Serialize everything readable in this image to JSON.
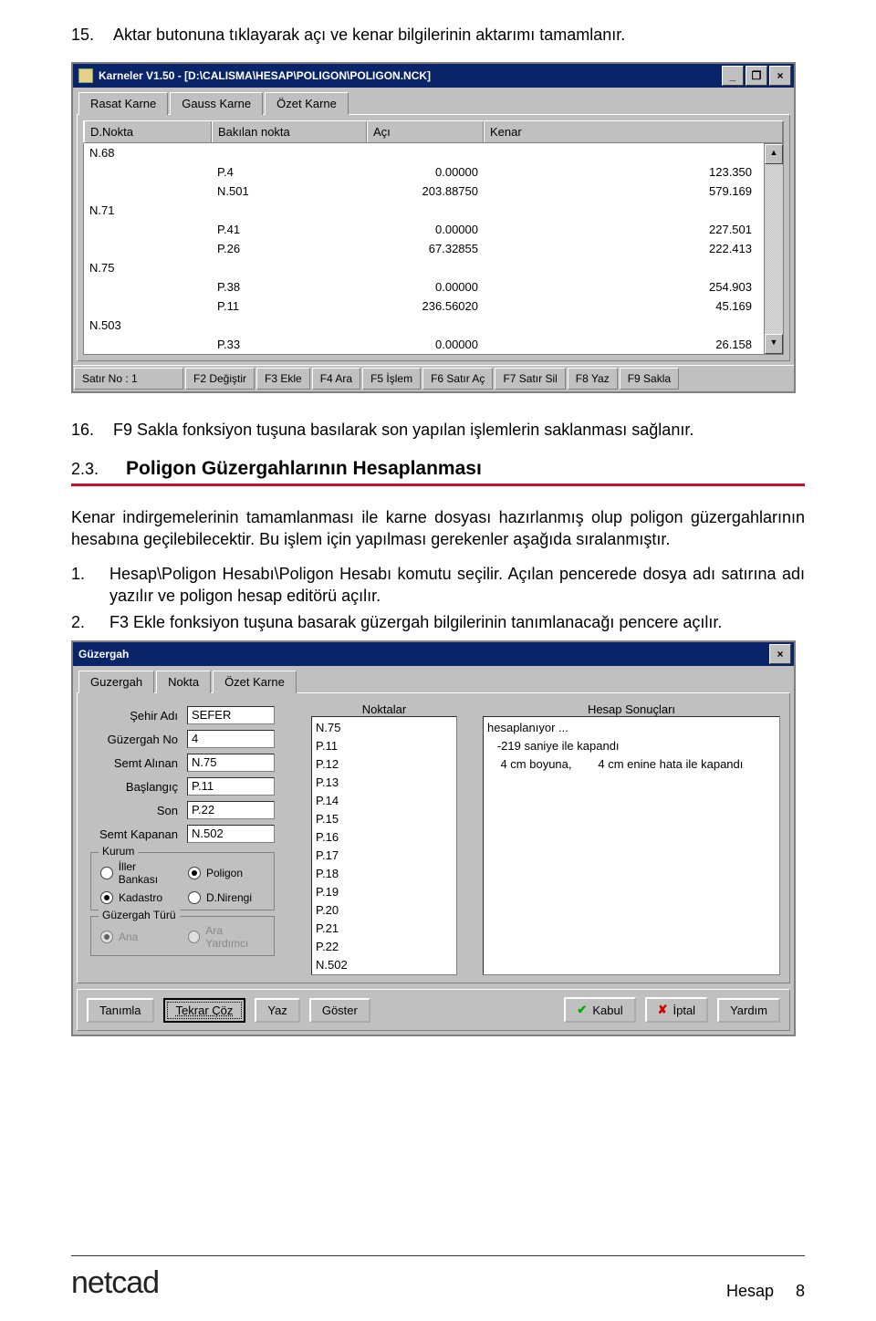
{
  "intro": {
    "item15_num": "15.",
    "item15_text": "Aktar butonuna tıklayarak açı ve kenar bilgilerinin aktarımı tamamlanır."
  },
  "karneler_window": {
    "title": "Karneler V1.50 - [D:\\CALISMA\\HESAP\\POLIGON\\POLIGON.NCK]",
    "min": "_",
    "max": "❐",
    "close": "×",
    "tabs": {
      "t1": "Rasat Karne",
      "t2": "Gauss Karne",
      "t3": "Özet Karne"
    },
    "headers": {
      "c0": "D.Nokta",
      "c1": "Bakılan nokta",
      "c2": "Açı",
      "c3": "Kenar"
    },
    "rows": [
      {
        "c0": "N.68",
        "c1": "",
        "c2": "",
        "c3": "",
        "hl": true
      },
      {
        "c0": "",
        "c1": "P.4",
        "c2": "0.00000",
        "c3": "123.350"
      },
      {
        "c0": "",
        "c1": "N.501",
        "c2": "203.88750",
        "c3": "579.169"
      },
      {
        "c0": "N.71",
        "c1": "",
        "c2": "",
        "c3": "",
        "hl": true
      },
      {
        "c0": "",
        "c1": "P.41",
        "c2": "0.00000",
        "c3": "227.501"
      },
      {
        "c0": "",
        "c1": "P.26",
        "c2": "67.32855",
        "c3": "222.413"
      },
      {
        "c0": "N.75",
        "c1": "",
        "c2": "",
        "c3": "",
        "hl": true
      },
      {
        "c0": "",
        "c1": "P.38",
        "c2": "0.00000",
        "c3": "254.903"
      },
      {
        "c0": "",
        "c1": "P.11",
        "c2": "236.56020",
        "c3": "45.169"
      },
      {
        "c0": "N.503",
        "c1": "",
        "c2": "",
        "c3": "",
        "hl": true
      },
      {
        "c0": "",
        "c1": "P.33",
        "c2": "0.00000",
        "c3": "26.158"
      }
    ],
    "scroll_up": "▲",
    "scroll_down": "▼",
    "status": {
      "s0": "Satır No : 1",
      "s1": "F2 Değiştir",
      "s2": "F3 Ekle",
      "s3": "F4 Ara",
      "s4": "F5 İşlem",
      "s5": "F6 Satır Aç",
      "s6": "F7 Satır Sil",
      "s7": "F8 Yaz",
      "s8": "F9 Sakla"
    }
  },
  "post_text": {
    "item16_num": "16.",
    "item16_text": "F9 Sakla fonksiyon tuşuna basılarak son yapılan işlemlerin saklanması sağlanır."
  },
  "section": {
    "num": "2.3.",
    "title": "Poligon Güzergahlarının Hesaplanması"
  },
  "para1": "Kenar indirgemelerinin tamamlanması ile karne dosyası hazırlanmış olup poligon güzergahlarının hesabına geçilebilecektir. Bu işlem için yapılması gerekenler aşağıda sıralanmıştır.",
  "steps": {
    "s1_num": "1.",
    "s1_text": "Hesap\\Poligon Hesabı\\Poligon Hesabı komutu seçilir. Açılan pencerede dosya adı satırına  adı yazılır ve poligon hesap editörü açılır.",
    "s2_num": "2.",
    "s2_text": "F3 Ekle fonksiyon tuşuna basarak güzergah bilgilerinin tanımlanacağı pencere açılır."
  },
  "guzergah_window": {
    "title": "Güzergah",
    "close": "×",
    "tabs": {
      "t1": "Guzergah",
      "t2": "Nokta",
      "t3": "Özet Karne"
    },
    "labels": {
      "sehir": "Şehir Adı",
      "guzno": "Güzergah No",
      "semta": "Semt Alınan",
      "bas": "Başlangıç",
      "son": "Son",
      "semtk": "Semt Kapanan"
    },
    "values": {
      "sehir": "SEFER",
      "guzno": "4",
      "semta": "N.75",
      "bas": "P.11",
      "son": "P.22",
      "semtk": "N.502"
    },
    "kurum": {
      "legend": "Kurum",
      "r1": "İller Bankası",
      "r2": "Poligon",
      "r3": "Kadastro",
      "r4": "D.Nirengi"
    },
    "turu": {
      "legend": "Güzergah Türü",
      "r1": "Ana",
      "r2": "Ara Yardımcı"
    },
    "noktalar_head": "Noktalar",
    "sonuc_head": "Hesap Sonuçları",
    "noktalar": [
      "N.75",
      "P.11",
      "P.12",
      "P.13",
      "P.14",
      "P.15",
      "P.16",
      "P.17",
      "P.18",
      "P.19",
      "P.20",
      "P.21",
      "P.22",
      "N.502"
    ],
    "sonuc": [
      "hesaplanıyor ...",
      "   -219 saniye ile kapandı",
      "    4 cm boyuna,        4 cm enine hata ile kapandı"
    ],
    "buttons": {
      "tanimla": "Tanımla",
      "tekrar": "Tekrar Çöz",
      "yaz": "Yaz",
      "goster": "Göster",
      "kabul": "Kabul",
      "iptal": "İptal",
      "yardim": "Yardım"
    }
  },
  "footer": {
    "logo": "netcad",
    "label": "Hesap",
    "page": "8"
  }
}
